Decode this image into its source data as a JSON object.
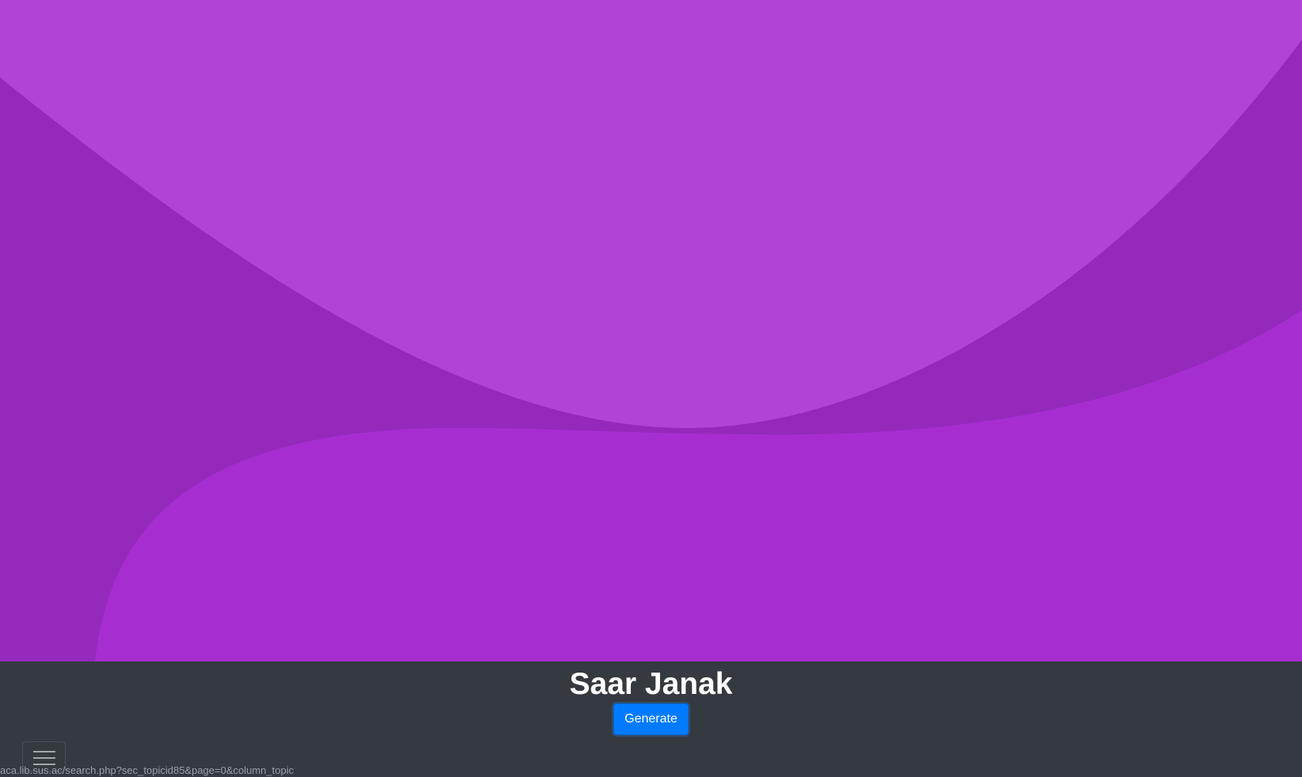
{
  "hero": {
    "colors": {
      "base": "#9529bc",
      "top_wave": "#b044d6",
      "bottom_wave": "#a62ed1"
    }
  },
  "footer": {
    "title": "Saar Janak",
    "generate_label": "Generate",
    "menu_icon": "hamburger-menu-icon",
    "status_url": "aca.lib.sus.ac/search.php?sec_topicid85&page=0&column_topic"
  },
  "colors": {
    "footer_bg": "#343a40",
    "button": "#007bff"
  }
}
